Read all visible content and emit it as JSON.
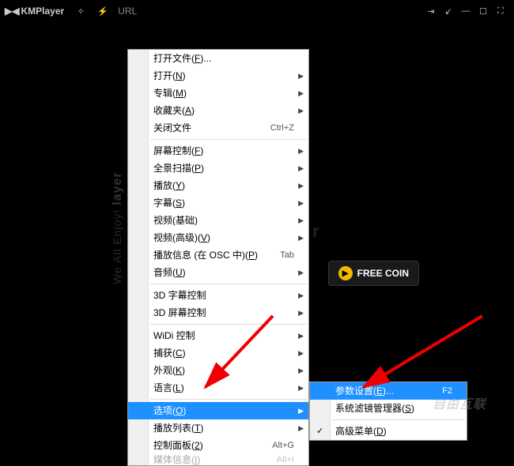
{
  "titlebar": {
    "logo": "KMPlayer",
    "url_label": "URL"
  },
  "vertical_brand": {
    "we": "We All Enjoy!",
    "km": "layer"
  },
  "freecoin": {
    "label": "FREE COIN"
  },
  "main_menu": [
    {
      "label": "打开文件(F)...",
      "u": "F",
      "arrow": false
    },
    {
      "label": "打开(N)",
      "u": "N",
      "arrow": true
    },
    {
      "label": "专辑(M)",
      "u": "M",
      "arrow": true
    },
    {
      "label": "收藏夹(A)",
      "u": "A",
      "arrow": true
    },
    {
      "label": "关闭文件",
      "shortcut": "Ctrl+Z"
    },
    {
      "sep": true
    },
    {
      "label": "屏幕控制(F)",
      "u": "F",
      "arrow": true
    },
    {
      "label": "全景扫描(P)",
      "u": "P",
      "arrow": true
    },
    {
      "label": "播放(Y)",
      "u": "Y",
      "arrow": true
    },
    {
      "label": "字幕(S)",
      "u": "S",
      "arrow": true
    },
    {
      "label": "视频(基础)",
      "arrow": true
    },
    {
      "label": "视频(高级)(V)",
      "u": "V",
      "arrow": true
    },
    {
      "label": "播放信息 (在 OSC 中)(P)",
      "u": "P",
      "shortcut": "Tab"
    },
    {
      "label": "音频(U)",
      "u": "U",
      "arrow": true
    },
    {
      "sep": true
    },
    {
      "label": "3D 字幕控制",
      "arrow": true
    },
    {
      "label": "3D 屏幕控制",
      "arrow": true
    },
    {
      "sep": true
    },
    {
      "label": "WiDi 控制",
      "arrow": true
    },
    {
      "label": "捕获(C)",
      "u": "C",
      "arrow": true
    },
    {
      "label": "外观(K)",
      "u": "K",
      "arrow": true
    },
    {
      "label": "语言(L)",
      "u": "L",
      "arrow": true
    },
    {
      "sep": true
    },
    {
      "label": "选项(O)",
      "u": "O",
      "arrow": true,
      "highlight": true
    },
    {
      "label": "播放列表(T)",
      "u": "T",
      "arrow": true
    },
    {
      "label": "控制面板(2)",
      "u": "2",
      "shortcut": "Alt+G"
    },
    {
      "label": "媒体信息(I)",
      "u": "I",
      "shortcut": "Alt+I",
      "cut": true
    }
  ],
  "sub_menu": [
    {
      "label": "参数设置(E)...",
      "u": "E",
      "shortcut": "F2",
      "highlight": true
    },
    {
      "label": "系统滤镜管理器(S)",
      "u": "S"
    },
    {
      "sep": true
    },
    {
      "label": "高级菜单(D)",
      "u": "D",
      "checked": true
    }
  ],
  "watermark": "自由互联"
}
